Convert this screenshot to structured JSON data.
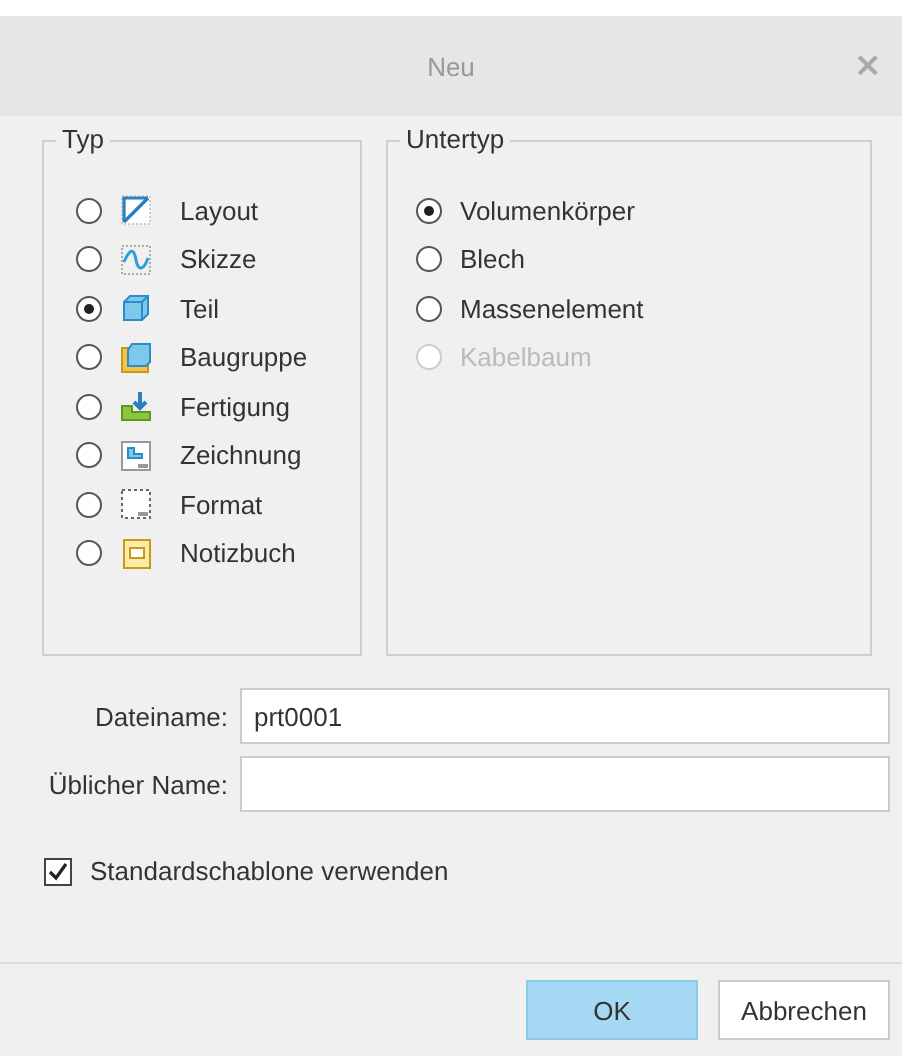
{
  "window": {
    "title": "Neu",
    "close": "×"
  },
  "typ": {
    "label": "Typ",
    "items": [
      {
        "label": "Layout",
        "kind": "layout",
        "selected": false
      },
      {
        "label": "Skizze",
        "kind": "sketch",
        "selected": false
      },
      {
        "label": "Teil",
        "kind": "part",
        "selected": true
      },
      {
        "label": "Baugruppe",
        "kind": "assembly",
        "selected": false
      },
      {
        "label": "Fertigung",
        "kind": "manufacturing",
        "selected": false
      },
      {
        "label": "Zeichnung",
        "kind": "drawing",
        "selected": false
      },
      {
        "label": "Format",
        "kind": "format",
        "selected": false
      },
      {
        "label": "Notizbuch",
        "kind": "notebook",
        "selected": false
      }
    ]
  },
  "untertyp": {
    "label": "Untertyp",
    "items": [
      {
        "label": "Volumenkörper",
        "selected": true,
        "disabled": false
      },
      {
        "label": "Blech",
        "selected": false,
        "disabled": false
      },
      {
        "label": "Massenelement",
        "selected": false,
        "disabled": false
      },
      {
        "label": "Kabelbaum",
        "selected": false,
        "disabled": true
      }
    ]
  },
  "fields": [
    {
      "label": "Dateiname:",
      "value": "prt0001"
    },
    {
      "label": "Üblicher Name:"
    }
  ],
  "checkbox": {
    "label": "Standardschablone verwenden",
    "checked": true
  },
  "buttons": [
    {
      "label": "OK",
      "primary": true
    },
    {
      "label": "Abbrechen",
      "primary": false
    }
  ]
}
